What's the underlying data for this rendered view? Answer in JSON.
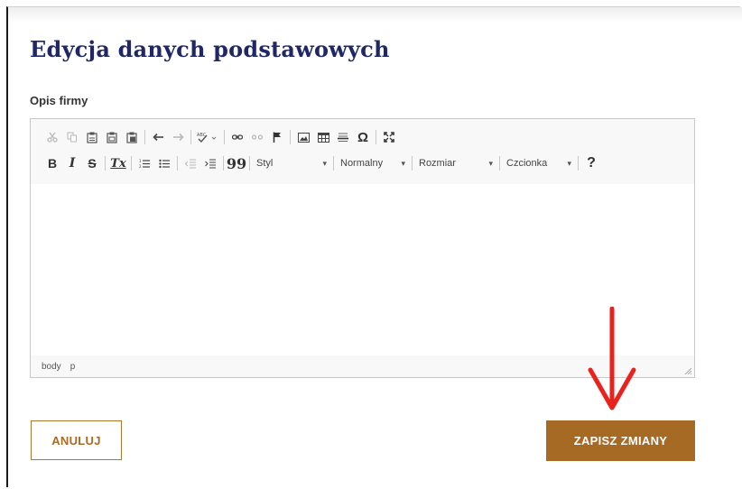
{
  "page": {
    "title": "Edycja danych podstawowych",
    "field_label": "Opis firmy"
  },
  "editor": {
    "toolbar_row1_icons": [
      "cut-icon",
      "copy-icon",
      "paste-icon",
      "paste-text-icon",
      "paste-word-icon",
      "undo-icon",
      "redo-icon",
      "spellcheck-icon",
      "link-icon",
      "unlink-icon",
      "anchor-icon",
      "image-icon",
      "table-icon",
      "horizontal-line-icon",
      "special-char-icon",
      "maximize-icon"
    ],
    "toolbar_row2": {
      "bold": "B",
      "italic": "I",
      "strike": "S",
      "remove_format": "Tx",
      "blockquote": "99",
      "style_combo": "Styl",
      "format_combo": "Normalny",
      "size_combo": "Rozmiar",
      "font_combo": "Czcionka",
      "help": "?"
    },
    "content": "",
    "statusbar": {
      "path1": "body",
      "path2": "p"
    }
  },
  "actions": {
    "cancel_label": "ANULUJ",
    "save_label": "ZAPISZ ZMIANY"
  },
  "colors": {
    "title": "#1f2767",
    "accent": "#a76a24",
    "annotation_arrow": "#e8231d"
  }
}
